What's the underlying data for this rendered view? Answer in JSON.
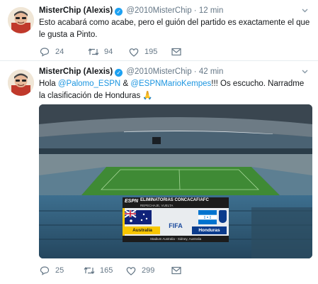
{
  "tweets": [
    {
      "name": "MisterChip (Alexis)",
      "handle": "@2010MisterChip",
      "separator": "·",
      "time": "12 min",
      "text": "Esto acabará como acabe, pero el guión del partido es exactamente el que le gusta a Pinto.",
      "replies": "24",
      "retweets": "94",
      "likes": "195"
    },
    {
      "name": "MisterChip (Alexis)",
      "handle": "@2010MisterChip",
      "separator": "·",
      "time": "42 min",
      "text_parts": {
        "prefix": "Hola ",
        "mention1": "@Palomo_ESPN",
        "amp": " & ",
        "mention2": "@ESPNMarioKempes",
        "suffix": "!!! Os escucho. Narradme la clasificación de Honduras",
        "emoji": "🙏"
      },
      "replies": "25",
      "retweets": "165",
      "likes": "299",
      "scoreboard": {
        "brand": "ESPN",
        "title": "ELIMINATORIAS CONCACAF/AFC",
        "subtitle": "REPECHAJE, VUELTA",
        "home": "Australia",
        "away": "Honduras",
        "center": "FIFA",
        "venue": "Stadium Australia - Sidney, Australia"
      }
    }
  ],
  "icons": {
    "verified": "verified-badge-icon",
    "caret": "chevron-down-icon",
    "reply": "reply-icon",
    "retweet": "retweet-icon",
    "like": "heart-icon",
    "dm": "envelope-icon"
  },
  "colors": {
    "link": "#1b95e0",
    "verified": "#1da1f2",
    "secondary": "#657786"
  }
}
